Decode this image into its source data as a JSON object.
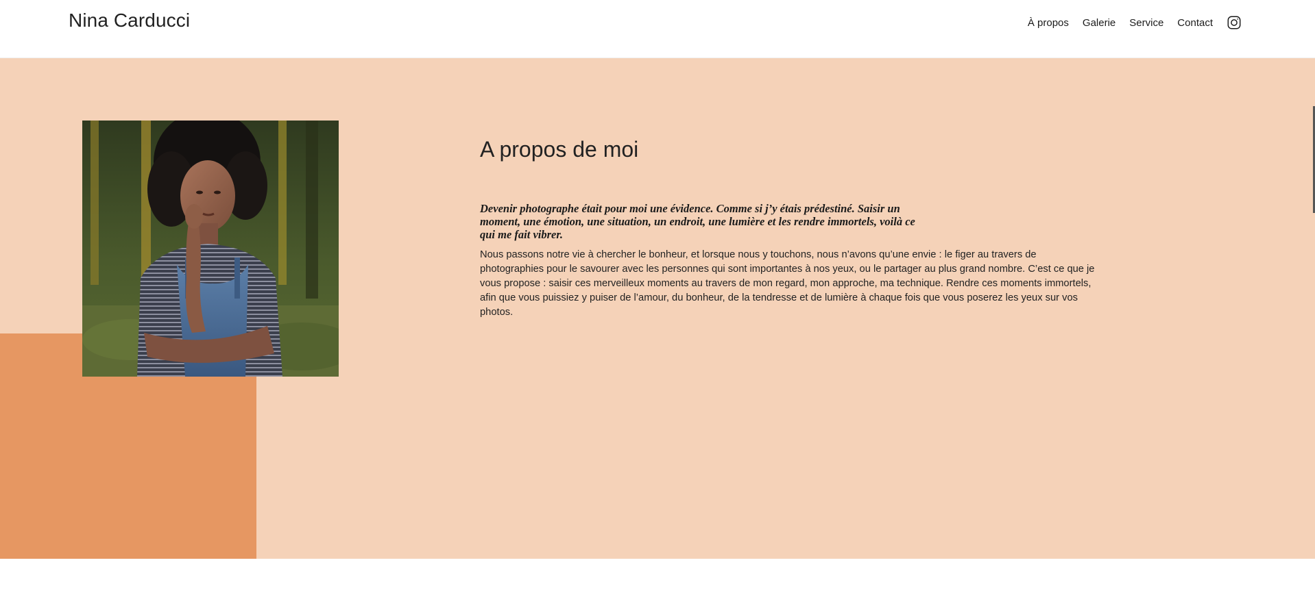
{
  "site": {
    "brand": "Nina Carducci"
  },
  "nav": {
    "items": [
      {
        "label": "À propos"
      },
      {
        "label": "Galerie"
      },
      {
        "label": "Service"
      },
      {
        "label": "Contact"
      }
    ],
    "instagram_icon": "instagram-icon"
  },
  "about": {
    "title": "A propos de moi",
    "lead": "Devenir photographe était pour moi une évidence. Comme si j’y étais prédestiné. Saisir un moment, une émotion, une situation, un endroit, une lumière et les rendre immortels, voilà ce qui me fait vibrer.",
    "body": "Nous passons notre vie à chercher le bonheur, et lorsque nous y touchons, nous n’avons qu’une envie : le figer au travers de photographies pour le savourer avec les personnes qui sont importantes à nos yeux, ou le partager au plus grand nombre. C’est ce que je vous propose : saisir ces merveilleux moments au travers de mon regard, mon approche, ma technique. Rendre ces moments immortels, afin que vous puissiez y puiser de l’amour, du bonheur, de la tendresse et de lumière à chaque fois que vous poserez les yeux sur vos photos."
  },
  "colors": {
    "section_bg": "#f5d2b8",
    "accent_block": "#e69762",
    "text": "#1a1a1a"
  }
}
